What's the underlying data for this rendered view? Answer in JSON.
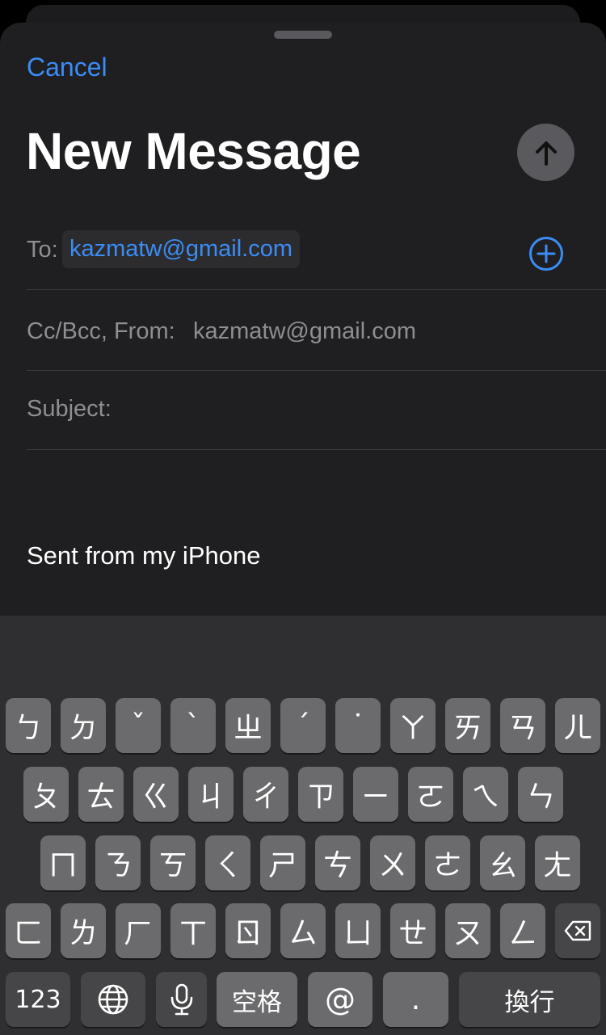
{
  "compose": {
    "cancel_label": "Cancel",
    "title": "New Message",
    "to_label": "To:",
    "to_recipient": "kazmatw@gmail.com",
    "cc_label": "Cc/Bcc, From:",
    "from_value": "kazmatw@gmail.com",
    "subject_label": "Subject:",
    "signature": "Sent from my iPhone"
  },
  "keyboard": {
    "row1": [
      "ㄅ",
      "ㄉ",
      "ˇ",
      "ˋ",
      "ㄓ",
      "ˊ",
      "˙",
      "ㄚ",
      "ㄞ",
      "ㄢ",
      "ㄦ"
    ],
    "row2": [
      "ㄆ",
      "ㄊ",
      "ㄍ",
      "ㄐ",
      "ㄔ",
      "ㄗ",
      "ㄧ",
      "ㄛ",
      "ㄟ",
      "ㄣ"
    ],
    "row3": [
      "ㄇ",
      "ㄋ",
      "ㄎ",
      "ㄑ",
      "ㄕ",
      "ㄘ",
      "ㄨ",
      "ㄜ",
      "ㄠ",
      "ㄤ"
    ],
    "row4": [
      "ㄈ",
      "ㄌ",
      "ㄏ",
      "ㄒ",
      "ㄖ",
      "ㄙ",
      "ㄩ",
      "ㄝ",
      "ㄡ",
      "ㄥ"
    ],
    "numbers_label": "123",
    "space_label": "空格",
    "at_label": "@",
    "period_label": ".",
    "return_label": "換行"
  },
  "colors": {
    "accent": "#3b8cf5",
    "sheet_background": "#1f1f21",
    "key_background": "#6b6b6d"
  }
}
